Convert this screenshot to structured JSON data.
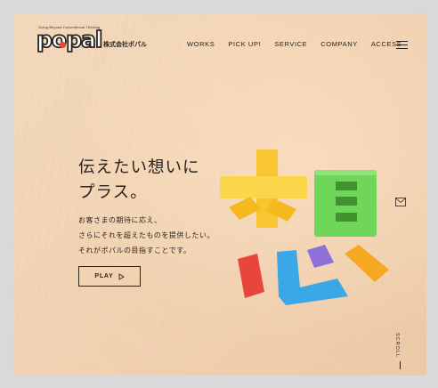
{
  "header": {
    "logo_tagline": "Going Beyond Conventional Thinking",
    "logo_text": "popal",
    "company_name": "株式会社ポパル",
    "nav": [
      "WORKS",
      "PICK UP!",
      "SERVICE",
      "COMPANY",
      "ACCESS"
    ],
    "menu_icon": "hamburger-icon"
  },
  "hero": {
    "title_line1": "伝えたい想いに",
    "title_line2": "プラス。",
    "sub_line1": "お客さまの期待に応え、",
    "sub_line2": "さらにそれを超えたものを提供したい。",
    "sub_line3": "それがポパルの目指すことです。",
    "play_label": "PLAY",
    "play_icon": "play-triangle-icon"
  },
  "side": {
    "mail_icon": "envelope-icon",
    "scroll_label": "SCROLL"
  },
  "colors": {
    "text": "#2a2320",
    "block_yellow": "#f7c630",
    "block_green": "#6fd65a",
    "block_blue": "#3aa8e6",
    "block_red": "#e8453c",
    "block_purple": "#8f6fd8",
    "block_orange": "#f7a823"
  }
}
